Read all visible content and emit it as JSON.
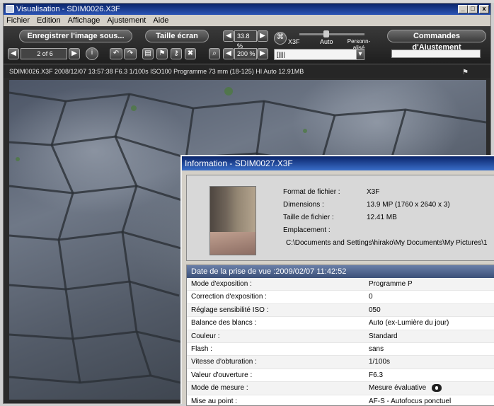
{
  "window": {
    "title": "Visualisation - SDIM0026.X3F",
    "controls": {
      "minimize": "_",
      "maximize": "□",
      "close": "x"
    }
  },
  "menu": [
    "Fichier",
    "Edition",
    "Affichage",
    "Ajustement",
    "Aide"
  ],
  "toolbar": {
    "save_label": "Enregistrer l'image sous...",
    "fit_label": "Taille écran",
    "zoom_value": "33.8 %",
    "mode_x3f": "X3F",
    "mode_auto": "Auto",
    "mode_custom": "Personn-\nalisé",
    "adjust_label": "Commandes d'Ajustement",
    "page_indicator": "2 of 6",
    "zoom2_value": "200 %",
    "combo_value": "[||||"
  },
  "caption": "SDIM0026.X3F 2008/12/07 13:57:38 F6.3 1/100s ISO100 Programme 73 mm (18-125) HI Auto 12.91MB",
  "info": {
    "title": "Information - SDIM0027.X3F",
    "format_label": "Format de fichier :",
    "format_value": "X3F",
    "dimensions_label": "Dimensions :",
    "dimensions_value": "13.9 MP (1760 x 2640 x 3)",
    "size_label": "Taille de fichier :",
    "size_value": "12.41 MB",
    "location_label": "Emplacement :",
    "location_value": "C:\\Documents and Settings\\hirako\\My Documents\\My Pictures\\1",
    "date_header": "Date de la prise de vue :2009/02/07 11:42:52",
    "rows": [
      {
        "k": "Mode d'exposition :",
        "v": "Programme P"
      },
      {
        "k": "Correction d'exposition :",
        "v": "0"
      },
      {
        "k": "Réglage sensibilité ISO :",
        "v": "050"
      },
      {
        "k": "Balance des blancs :",
        "v": "Auto (ex-Lumière du jour)"
      },
      {
        "k": "Couleur :",
        "v": "Standard"
      },
      {
        "k": "Flash :",
        "v": "sans"
      },
      {
        "k": "Vitesse d'obturation :",
        "v": "1/100s"
      },
      {
        "k": "Valeur d'ouverture :",
        "v": "F6.3"
      },
      {
        "k": "Mode de mesure :",
        "v": "Mesure évaluative"
      },
      {
        "k": "Mise au point :",
        "v": "AF-S - Autofocus ponctuel"
      }
    ]
  },
  "colors": {
    "titlebar": "#0a246a",
    "toolbar": "#2a2a2a",
    "table_header": "#4a5f88"
  }
}
